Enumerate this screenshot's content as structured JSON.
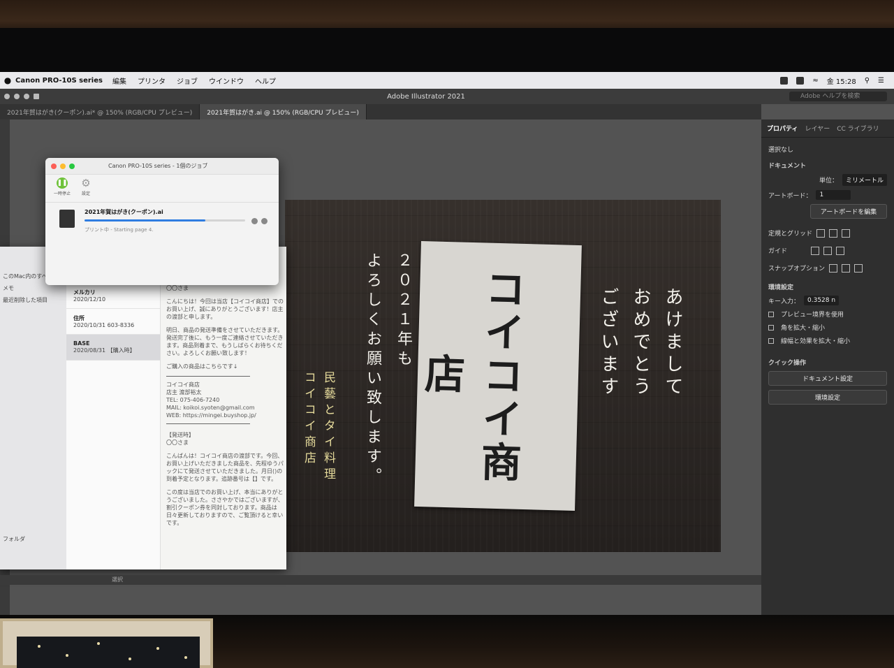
{
  "menubar": {
    "app": "Canon PRO-10S series",
    "items": [
      "編集",
      "プリンタ",
      "ジョブ",
      "ウインドウ",
      "ヘルプ"
    ],
    "clock": "金 15:28"
  },
  "window": {
    "title": "Adobe Illustrator 2021",
    "search_placeholder": "Adobe ヘルプを検索"
  },
  "tabs": [
    {
      "label": "2021年賀はがき(クーポン).ai* @ 150% (RGB/CPU プレビュー)"
    },
    {
      "label": "2021年賀はがき.ai @ 150% (RGB/CPU プレビュー)"
    }
  ],
  "artboard": {
    "card_text": "コイコイ商店",
    "greeting": "あけまして\nおめでとう\nございます",
    "year_message": "２０２１年も\nよろしくお願い致します。",
    "shop_tagline": "民藝とタイ料理\nコイコイ商店"
  },
  "panel": {
    "tabs": [
      "プロパティ",
      "レイヤー",
      "CC ライブラリ"
    ],
    "selection": "選択なし",
    "document_label": "ドキュメント",
    "unit_label": "単位：",
    "unit_value": "ミリメートル",
    "artboard_label": "アートボード：",
    "artboard_value": "1",
    "edit_artboard": "アートボードを編集",
    "rulers_grid": "定規とグリッド",
    "guides": "ガイド",
    "snap": "スナップオプション",
    "preferences": "環境設定",
    "key_increment_label": "キー入力：",
    "key_increment_value": "0.3528 n",
    "opt1": "プレビュー境界を使用",
    "opt2": "角を拡大・縮小",
    "opt3": "線幅と効果を拡大・縮小",
    "quick_actions": "クイック操作",
    "doc_setup": "ドキュメント設定",
    "prefs_btn": "環境設定"
  },
  "print_dialog": {
    "title": "Canon PRO-10S series - 1個のジョブ",
    "pause": "一時停止",
    "settings": "設定",
    "filename": "2021年賀はがき(クーポン).ai",
    "status": "プリント中 - Starting page 4.",
    "progress": 0.75
  },
  "mail": {
    "side_items": [
      "このMac内のすべて",
      "メモ",
      "最近削除した項目",
      "フォルダ"
    ],
    "list": [
      {
        "sender": "メルカリ",
        "date": "2020/12/10"
      },
      {
        "sender": "住所",
        "date": "2020/10/31",
        "extra": "603-8336"
      },
      {
        "sender": "BASE",
        "date": "2020/08/31",
        "extra": "【購入時】"
      }
    ],
    "body": {
      "greeting": "〇〇さま",
      "p1": "こんにちは！今回は当店【コイコイ商店】でのお買い上げ、誠にありがとうございます！店主の渡部と申します。",
      "p2": "明日、商品の発送準備をさせていただきます。発送完了後に、もう一度ご連絡させていただきます。商品到着まで、もうしばらくお待ちください。よろしくお願い致します！",
      "p3": "ご購入の商品はこちらです↓",
      "sig_shop": "コイコイ商店",
      "sig_owner": "店主 渡部裕太",
      "sig_tel": "TEL: 075-406-7240",
      "sig_mail": "MAIL: koikoi.syoten@gmail.com",
      "sig_web": "WEB: https://mingei.buyshop.jp/",
      "section": "【発送時】",
      "greeting2": "〇〇さま",
      "p4": "こんばんは！コイコイ商店の渡部です。今回、お買い上げいただきました商品を、先程ゆうパックにて発送させていただきました。月日()の到着予定となります。追跡番号は【】です。",
      "p5": "この度は当店でのお買い上げ、本当にありがとうございました。ささやかではございますが、割引クーポン券を同封しております。商品は日々更新しておりますので、ご覧頂けると幸いです。"
    }
  },
  "statusbar": {
    "tool": "選択"
  }
}
